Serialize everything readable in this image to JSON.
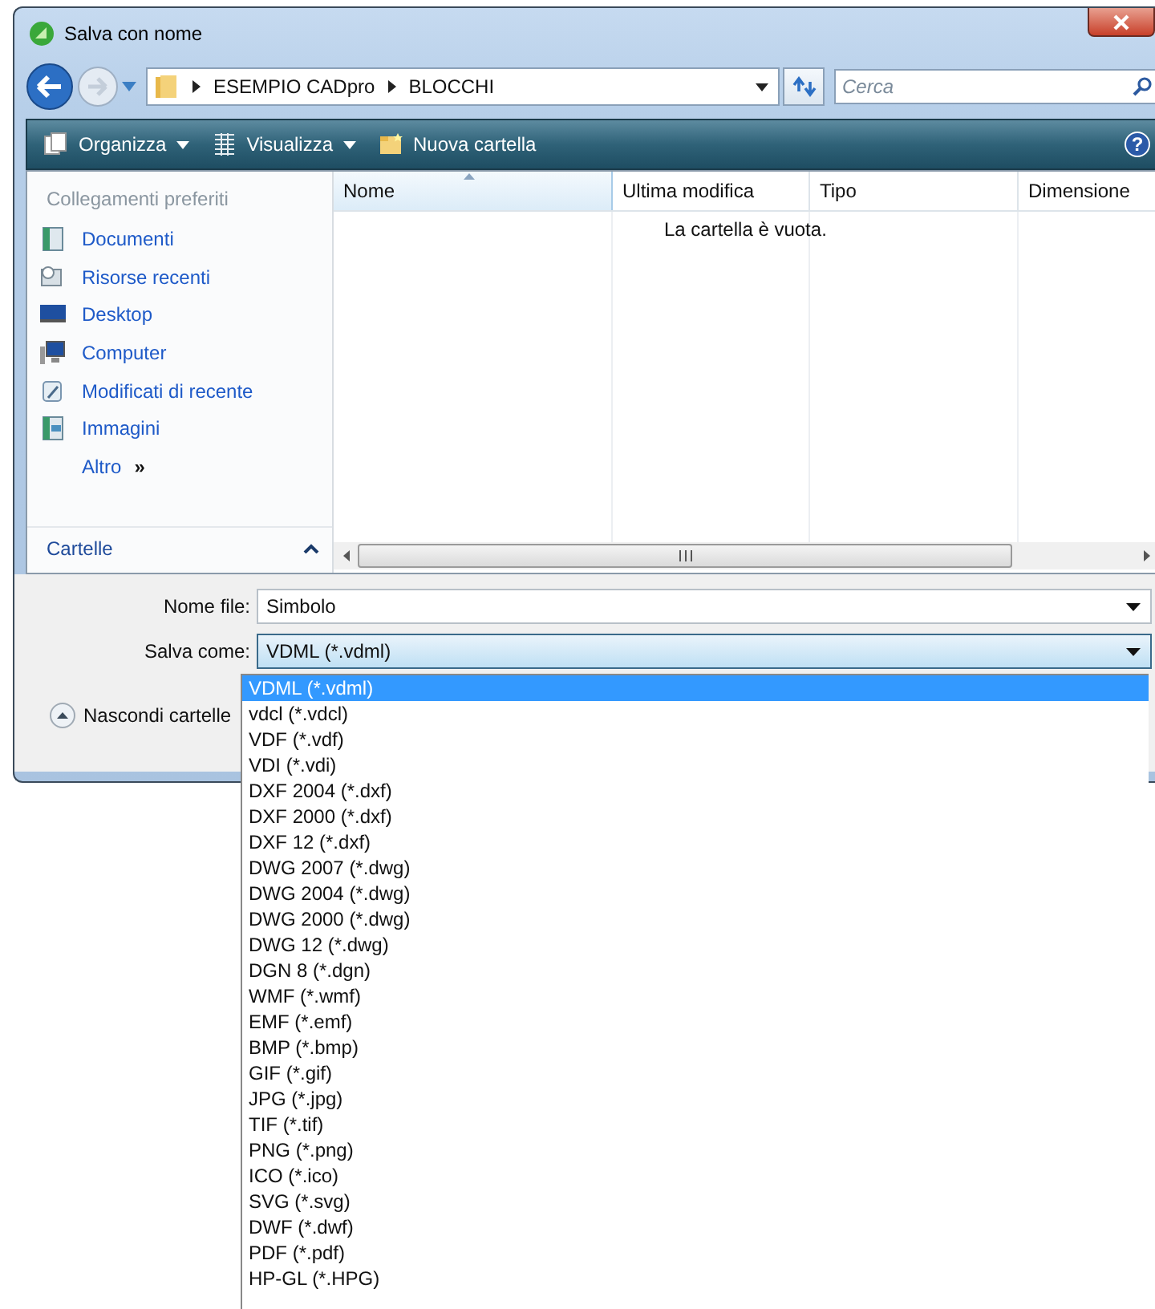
{
  "window": {
    "title": "Salva con nome"
  },
  "address_bar": {
    "path": [
      "ESEMPIO CADpro",
      "BLOCCHI"
    ]
  },
  "search": {
    "placeholder": "Cerca"
  },
  "help_button": {
    "label": "?"
  },
  "toolbar": [
    {
      "label": "Organizza",
      "kind": "organize"
    },
    {
      "label": "Visualizza",
      "kind": "views"
    },
    {
      "label": "Nuova cartella",
      "kind": "newfolder"
    }
  ],
  "sidebar": {
    "heading": "Collegamenti preferiti",
    "items": [
      {
        "label": "Documenti",
        "kind": "documents"
      },
      {
        "label": "Risorse recenti",
        "kind": "recent"
      },
      {
        "label": "Desktop",
        "kind": "desktop"
      },
      {
        "label": "Computer",
        "kind": "computer"
      },
      {
        "label": "Modificati di recente",
        "kind": "modified"
      },
      {
        "label": "Immagini",
        "kind": "pictures"
      },
      {
        "label": "Altro",
        "kind": "more",
        "suffix": "»"
      }
    ],
    "folders": {
      "label": "Cartelle"
    }
  },
  "file_list": {
    "columns": [
      {
        "label": "Nome",
        "sorted": true
      },
      {
        "label": "Ultima modifica",
        "sorted": false
      },
      {
        "label": "Tipo",
        "sorted": false
      },
      {
        "label": "Dimensione",
        "sorted": false
      }
    ],
    "empty_message": "La cartella è vuota."
  },
  "file_name": {
    "label": "Nome file:",
    "value": "Simbolo"
  },
  "save_as": {
    "label": "Salva come:",
    "value": "VDML (*.vdml)",
    "expanded": true,
    "options": [
      {
        "label": "VDML (*.vdml)",
        "selected": true
      },
      {
        "label": "vdcl (*.vdcl)",
        "selected": false
      },
      {
        "label": "VDF (*.vdf)",
        "selected": false
      },
      {
        "label": "VDI (*.vdi)",
        "selected": false
      },
      {
        "label": "DXF 2004 (*.dxf)",
        "selected": false
      },
      {
        "label": "DXF 2000 (*.dxf)",
        "selected": false
      },
      {
        "label": "DXF 12 (*.dxf)",
        "selected": false
      },
      {
        "label": "DWG 2007 (*.dwg)",
        "selected": false
      },
      {
        "label": "DWG 2004 (*.dwg)",
        "selected": false
      },
      {
        "label": "DWG 2000 (*.dwg)",
        "selected": false
      },
      {
        "label": "DWG 12 (*.dwg)",
        "selected": false
      },
      {
        "label": "DGN 8 (*.dgn)",
        "selected": false
      },
      {
        "label": "WMF (*.wmf)",
        "selected": false
      },
      {
        "label": "EMF (*.emf)",
        "selected": false
      },
      {
        "label": "BMP (*.bmp)",
        "selected": false
      },
      {
        "label": "GIF (*.gif)",
        "selected": false
      },
      {
        "label": "JPG (*.jpg)",
        "selected": false
      },
      {
        "label": "TIF (*.tif)",
        "selected": false
      },
      {
        "label": "PNG (*.png)",
        "selected": false
      },
      {
        "label": "ICO (*.ico)",
        "selected": false
      },
      {
        "label": "SVG (*.svg)",
        "selected": false
      },
      {
        "label": "DWF (*.dwf)",
        "selected": false
      },
      {
        "label": "PDF (*.pdf)",
        "selected": false
      },
      {
        "label": "HP-GL (*.HPG)",
        "selected": false
      }
    ]
  },
  "hide_folders": {
    "label": "Nascondi cartelle"
  }
}
